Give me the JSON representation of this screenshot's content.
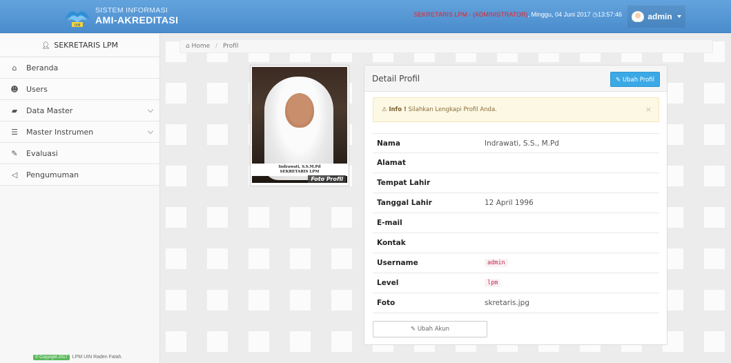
{
  "topbar": {
    "brand_line1": "SISTEM INFORMASI",
    "brand_line2": "AMI-AKREDITASI",
    "logo_text": "UIN",
    "status_role": "SEKRETARIS LPM - (ADMINISTRATOR)",
    "status_sep": ", ",
    "status_date": "Minggu, 04 Juni 2017",
    "status_time": "13:57:46",
    "user_name": "admin",
    "brand_color": "#4a8ccc"
  },
  "sidebar": {
    "header": "SEKRETARIS LPM",
    "items": [
      {
        "label": "Beranda",
        "icon": "home-icon"
      },
      {
        "label": "Users",
        "icon": "users-icon"
      },
      {
        "label": "Data Master",
        "icon": "folder-open-icon",
        "has_submenu": true
      },
      {
        "label": "Master Instrumen",
        "icon": "list-icon",
        "has_submenu": true
      },
      {
        "label": "Evaluasi",
        "icon": "edit-icon"
      },
      {
        "label": "Pengumuman",
        "icon": "bullhorn-icon"
      }
    ],
    "footer_badge": "© Copyright 2017",
    "footer_text": "LPM UIN Raden Fatah."
  },
  "breadcrumb": {
    "home": "Home",
    "current": "Profil"
  },
  "photo": {
    "label": "Foto Profil",
    "caption_line1": "Indrawati, S.S.M.Pd",
    "caption_line2": "SEKRETARIS LPM"
  },
  "panel": {
    "title": "Detail Profil",
    "edit_profile_button": "Ubah Profil",
    "alert_strong": "Info !",
    "alert_text": "Silahkan Lengkapi Profil Anda.",
    "alert_close": "×",
    "rows": [
      {
        "key": "Nama",
        "value": "Indrawati, S.S., M.Pd"
      },
      {
        "key": "Alamat",
        "value": ""
      },
      {
        "key": "Tempat Lahir",
        "value": ""
      },
      {
        "key": "Tanggal Lahir",
        "value": "12 April 1996"
      },
      {
        "key": "E-mail",
        "value": ""
      },
      {
        "key": "Kontak",
        "value": ""
      },
      {
        "key": "Username",
        "value": "admin"
      },
      {
        "key": "Level",
        "value": "lpm"
      },
      {
        "key": "Foto",
        "value": "skretaris.jpg"
      }
    ],
    "edit_account_button": "Ubah Akun"
  }
}
